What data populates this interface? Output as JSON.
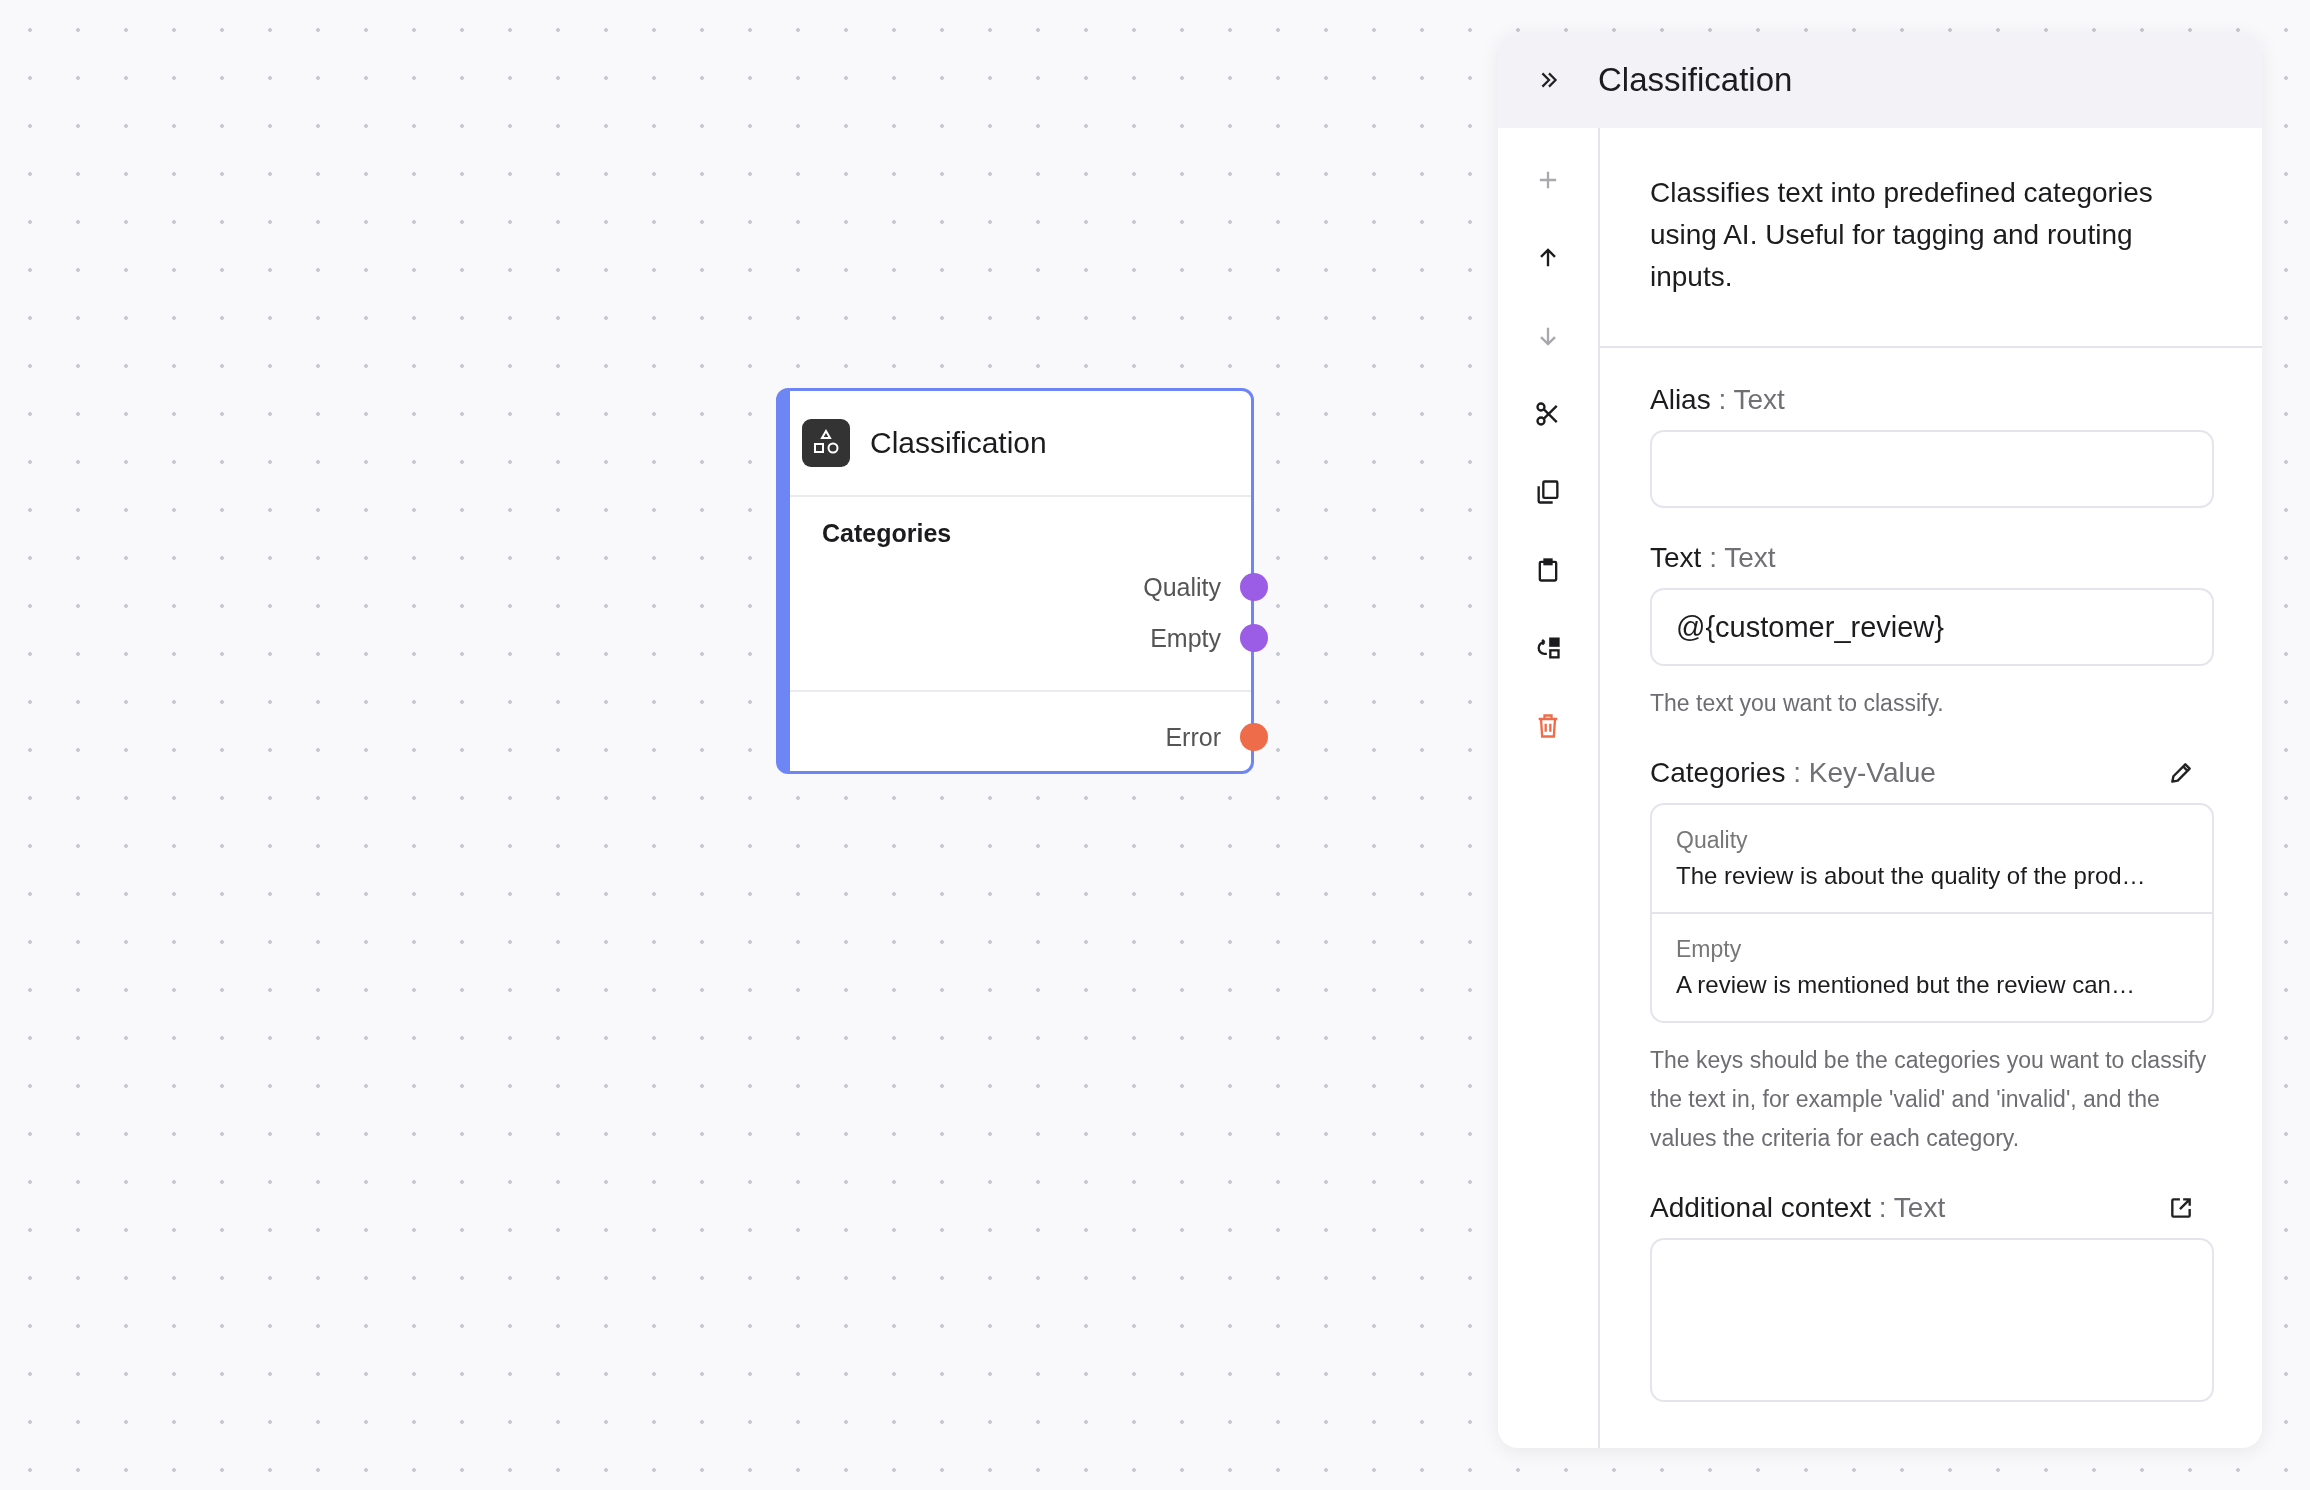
{
  "node": {
    "title": "Classification",
    "section_title": "Categories",
    "category_ports": [
      {
        "label": "Quality",
        "color": "#9b5de5"
      },
      {
        "label": "Empty",
        "color": "#9b5de5"
      }
    ],
    "error_port": {
      "label": "Error",
      "color": "#ef6c4a"
    },
    "selected": true
  },
  "panel": {
    "title": "Classification",
    "toolbar": [
      {
        "kind": "plus",
        "disabled": true
      },
      {
        "kind": "up",
        "disabled": false
      },
      {
        "kind": "down",
        "disabled": true
      },
      {
        "kind": "cut",
        "disabled": false
      },
      {
        "kind": "copy",
        "disabled": false
      },
      {
        "kind": "paste",
        "disabled": false
      },
      {
        "kind": "replace",
        "disabled": false
      },
      {
        "kind": "delete",
        "disabled": false
      }
    ],
    "description": "Classifies text into predefined categories using AI. Useful for tagging and routing inputs.",
    "fields": [
      {
        "kind": "text",
        "name": "Alias",
        "type": ": Text"
      },
      {
        "kind": "text",
        "name": "Text",
        "type": ": Text",
        "value": "@{customer_review}",
        "hint": "The text you want to classify."
      },
      {
        "kind": "keyvalue",
        "name": "Categories",
        "type": ": Key-Value",
        "entries": [
          {
            "key": "Quality",
            "value": "The review is about the quality of the prod…"
          },
          {
            "key": "Empty",
            "value": "A review is mentioned but the review can…"
          }
        ],
        "hint": "The keys should be the categories you want to classify the text in, for example 'valid' and 'invalid', and the values the criteria for each category."
      },
      {
        "kind": "textarea",
        "name": "Additional context",
        "type": ": Text"
      }
    ]
  }
}
